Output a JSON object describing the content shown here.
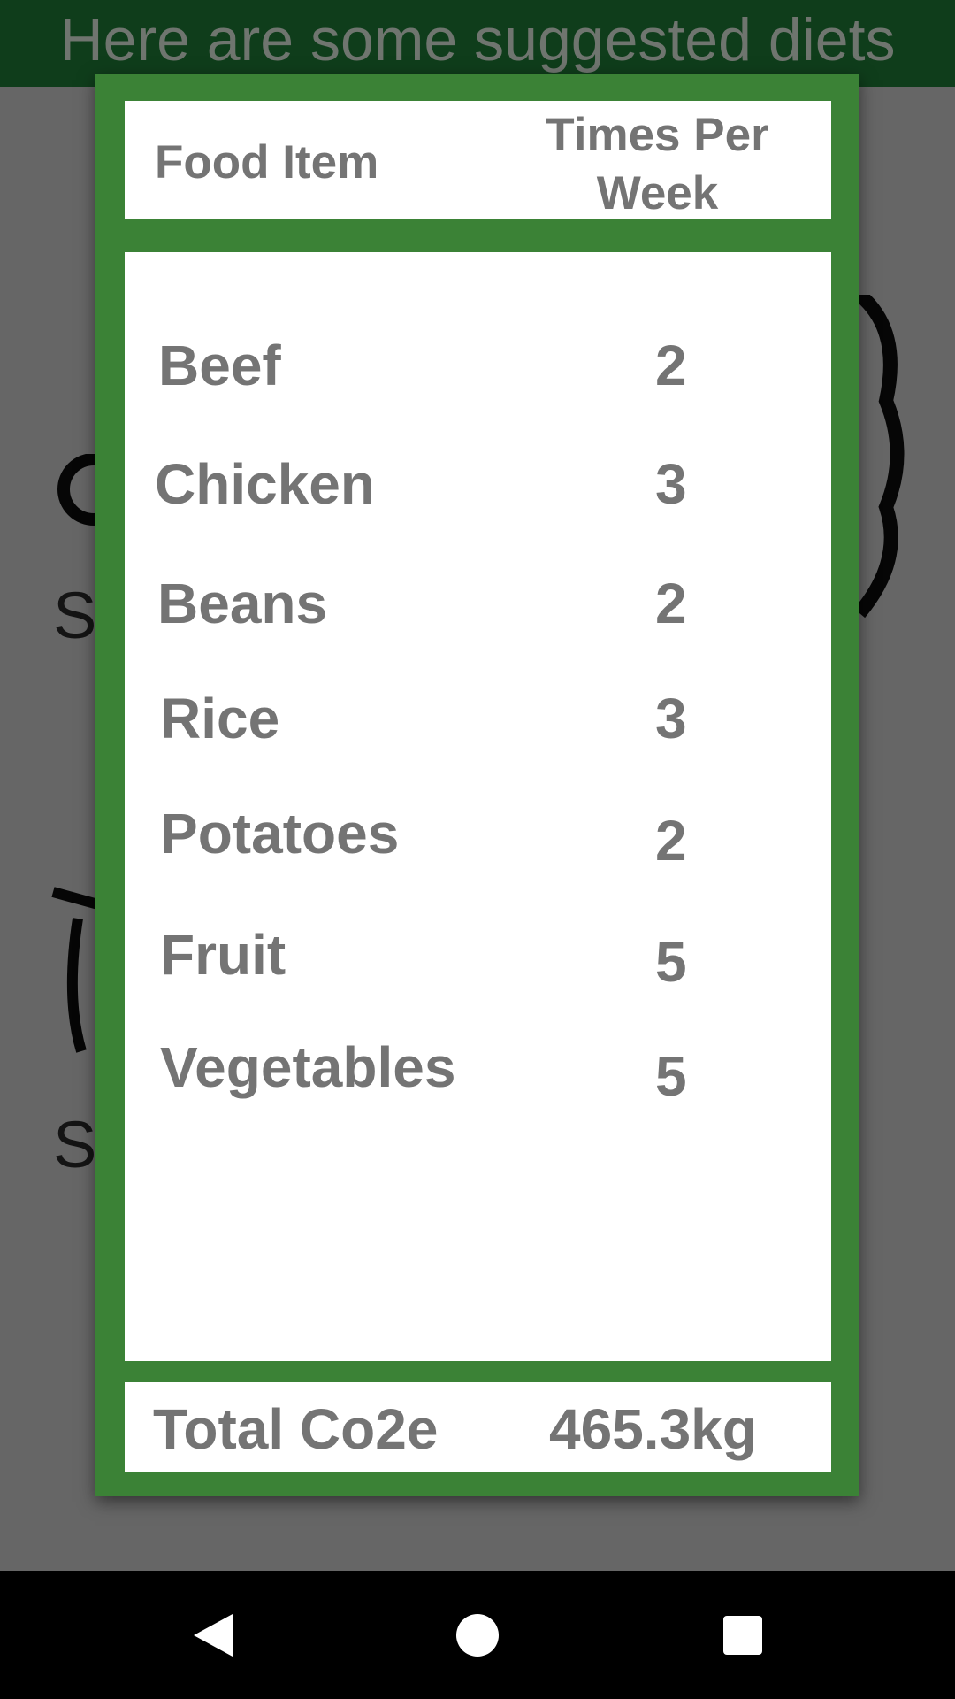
{
  "header": {
    "title": "Here are some suggested diets"
  },
  "background": {
    "labels": [
      "S",
      "S"
    ]
  },
  "dialog": {
    "columns": {
      "food_item": "Food Item",
      "times_per_week": "Times Per Week"
    },
    "rows": [
      {
        "name": "Beef",
        "times": "2"
      },
      {
        "name": "Chicken",
        "times": "3"
      },
      {
        "name": "Beans",
        "times": "2"
      },
      {
        "name": "Rice",
        "times": "3"
      },
      {
        "name": "Potatoes",
        "times": "2"
      },
      {
        "name": "Fruit",
        "times": "5"
      },
      {
        "name": "Vegetables",
        "times": "5"
      }
    ],
    "total": {
      "label": "Total Co2e",
      "value": "465.3kg"
    }
  },
  "navbar": {
    "icons": [
      "back-icon",
      "home-icon",
      "recents-icon"
    ]
  },
  "colors": {
    "header_bg": "#0f3d1b",
    "dialog_border": "#3b8236",
    "text_gray": "#747474"
  }
}
